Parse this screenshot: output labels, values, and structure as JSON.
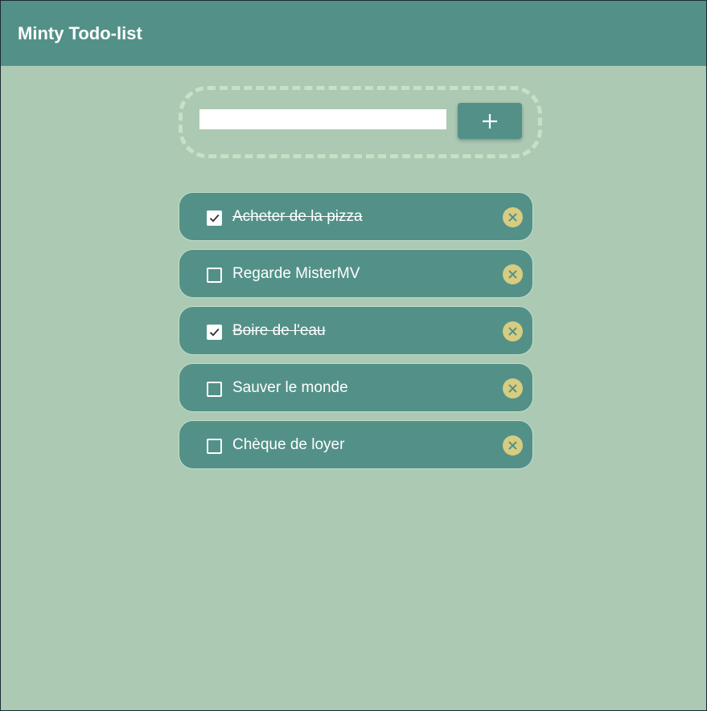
{
  "app": {
    "title": "Minty Todo-list"
  },
  "form": {
    "input_value": "",
    "input_placeholder": "",
    "add_icon": "plus-icon"
  },
  "todos": [
    {
      "label": "Acheter de la pizza",
      "done": true
    },
    {
      "label": "Regarde MisterMV",
      "done": false
    },
    {
      "label": "Boire de l'eau",
      "done": true
    },
    {
      "label": "Sauver le monde",
      "done": false
    },
    {
      "label": "Chèque de loyer",
      "done": false
    }
  ],
  "icons": {
    "delete": "close-icon",
    "check": "checkmark-icon"
  },
  "colors": {
    "background": "#abc9b3",
    "accent": "#539188",
    "delete_badge": "#d7cc80",
    "dashed_border": "#c8e0c6"
  }
}
